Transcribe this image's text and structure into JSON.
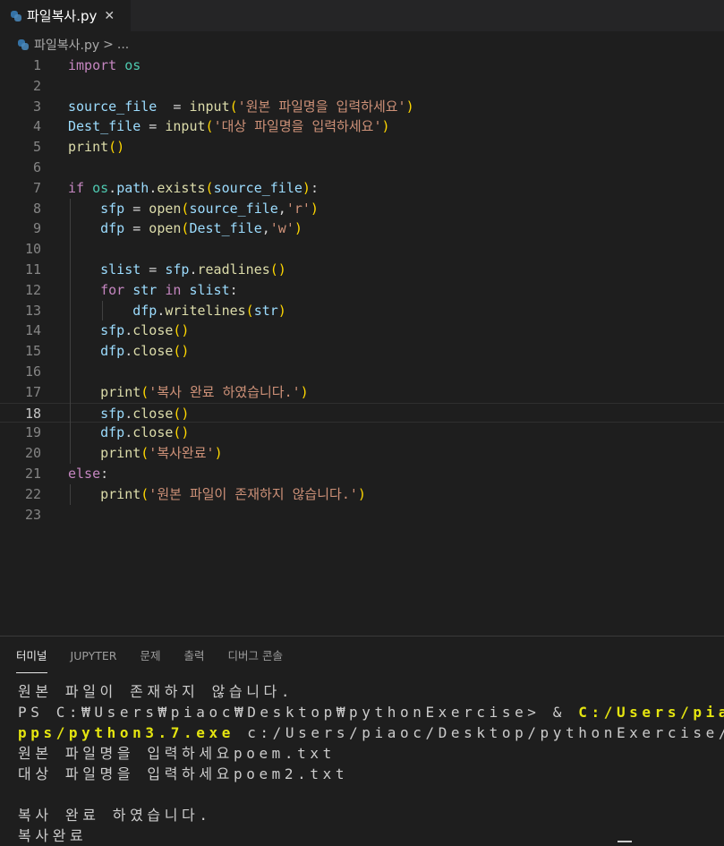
{
  "tab": {
    "title": "파일복사.py",
    "close": "✕"
  },
  "breadcrumb": {
    "file": "파일복사.py",
    "separator": ">",
    "more": "..."
  },
  "editor": {
    "current_line": 18,
    "lines": [
      {
        "n": "1",
        "indent": 0,
        "tokens": [
          [
            "kw",
            "import"
          ],
          [
            "op",
            " "
          ],
          [
            "mod",
            "os"
          ]
        ]
      },
      {
        "n": "2",
        "indent": 0,
        "tokens": []
      },
      {
        "n": "3",
        "indent": 0,
        "tokens": [
          [
            "var",
            "source_file"
          ],
          [
            "op",
            "  = "
          ],
          [
            "fn",
            "input"
          ],
          [
            "br1",
            "("
          ],
          [
            "str",
            "'원본 파일명을 입력하세요'"
          ],
          [
            "br1",
            ")"
          ]
        ]
      },
      {
        "n": "4",
        "indent": 0,
        "tokens": [
          [
            "var",
            "Dest_file"
          ],
          [
            "op",
            " = "
          ],
          [
            "fn",
            "input"
          ],
          [
            "br1",
            "("
          ],
          [
            "str",
            "'대상 파일명을 입력하세요'"
          ],
          [
            "br1",
            ")"
          ]
        ]
      },
      {
        "n": "5",
        "indent": 0,
        "tokens": [
          [
            "fn",
            "print"
          ],
          [
            "br1",
            "()"
          ]
        ]
      },
      {
        "n": "6",
        "indent": 0,
        "tokens": []
      },
      {
        "n": "7",
        "indent": 0,
        "tokens": [
          [
            "kw",
            "if"
          ],
          [
            "op",
            " "
          ],
          [
            "mod",
            "os"
          ],
          [
            "op",
            "."
          ],
          [
            "var",
            "path"
          ],
          [
            "op",
            "."
          ],
          [
            "fn",
            "exists"
          ],
          [
            "br1",
            "("
          ],
          [
            "var",
            "source_file"
          ],
          [
            "br1",
            ")"
          ],
          [
            "op",
            ":"
          ]
        ]
      },
      {
        "n": "8",
        "indent": 1,
        "tokens": [
          [
            "var",
            "sfp"
          ],
          [
            "op",
            " = "
          ],
          [
            "fn",
            "open"
          ],
          [
            "br1",
            "("
          ],
          [
            "var",
            "source_file"
          ],
          [
            "op",
            ","
          ],
          [
            "str",
            "'r'"
          ],
          [
            "br1",
            ")"
          ]
        ]
      },
      {
        "n": "9",
        "indent": 1,
        "tokens": [
          [
            "var",
            "dfp"
          ],
          [
            "op",
            " = "
          ],
          [
            "fn",
            "open"
          ],
          [
            "br1",
            "("
          ],
          [
            "var",
            "Dest_file"
          ],
          [
            "op",
            ","
          ],
          [
            "str",
            "'w'"
          ],
          [
            "br1",
            ")"
          ]
        ]
      },
      {
        "n": "10",
        "indent": 1,
        "tokens": []
      },
      {
        "n": "11",
        "indent": 1,
        "tokens": [
          [
            "var",
            "slist"
          ],
          [
            "op",
            " = "
          ],
          [
            "var",
            "sfp"
          ],
          [
            "op",
            "."
          ],
          [
            "fn",
            "readlines"
          ],
          [
            "br1",
            "()"
          ]
        ]
      },
      {
        "n": "12",
        "indent": 1,
        "tokens": [
          [
            "kw",
            "for"
          ],
          [
            "op",
            " "
          ],
          [
            "var",
            "str"
          ],
          [
            "op",
            " "
          ],
          [
            "kw",
            "in"
          ],
          [
            "op",
            " "
          ],
          [
            "var",
            "slist"
          ],
          [
            "op",
            ":"
          ]
        ]
      },
      {
        "n": "13",
        "indent": 2,
        "tokens": [
          [
            "var",
            "dfp"
          ],
          [
            "op",
            "."
          ],
          [
            "fn",
            "writelines"
          ],
          [
            "br1",
            "("
          ],
          [
            "var",
            "str"
          ],
          [
            "br1",
            ")"
          ]
        ]
      },
      {
        "n": "14",
        "indent": 1,
        "tokens": [
          [
            "var",
            "sfp"
          ],
          [
            "op",
            "."
          ],
          [
            "fn",
            "close"
          ],
          [
            "br1",
            "()"
          ]
        ]
      },
      {
        "n": "15",
        "indent": 1,
        "tokens": [
          [
            "var",
            "dfp"
          ],
          [
            "op",
            "."
          ],
          [
            "fn",
            "close"
          ],
          [
            "br1",
            "()"
          ]
        ]
      },
      {
        "n": "16",
        "indent": 1,
        "tokens": []
      },
      {
        "n": "17",
        "indent": 1,
        "tokens": [
          [
            "fn",
            "print"
          ],
          [
            "br1",
            "("
          ],
          [
            "str",
            "'복사 완료 하였습니다.'"
          ],
          [
            "br1",
            ")"
          ]
        ]
      },
      {
        "n": "18",
        "indent": 1,
        "tokens": [
          [
            "var",
            "sfp"
          ],
          [
            "op",
            "."
          ],
          [
            "fn",
            "close"
          ],
          [
            "br1",
            "()"
          ]
        ]
      },
      {
        "n": "19",
        "indent": 1,
        "tokens": [
          [
            "var",
            "dfp"
          ],
          [
            "op",
            "."
          ],
          [
            "fn",
            "close"
          ],
          [
            "br1",
            "()"
          ]
        ]
      },
      {
        "n": "20",
        "indent": 1,
        "tokens": [
          [
            "fn",
            "print"
          ],
          [
            "br1",
            "("
          ],
          [
            "str",
            "'복사완료'"
          ],
          [
            "br1",
            ")"
          ]
        ]
      },
      {
        "n": "21",
        "indent": 0,
        "tokens": [
          [
            "kw",
            "else"
          ],
          [
            "op",
            ":"
          ]
        ]
      },
      {
        "n": "22",
        "indent": 1,
        "tokens": [
          [
            "fn",
            "print"
          ],
          [
            "br1",
            "("
          ],
          [
            "str",
            "'원본 파일이 존재하지 않습니다.'"
          ],
          [
            "br1",
            ")"
          ]
        ]
      },
      {
        "n": "23",
        "indent": 0,
        "tokens": []
      }
    ]
  },
  "panel": {
    "tabs": [
      "터미널",
      "JUPYTER",
      "문제",
      "출력",
      "디버그 콘솔"
    ],
    "active_tab": 0
  },
  "terminal": {
    "lines": [
      [
        [
          "plain",
          "원본 파일이 존재하지 않습니다."
        ]
      ],
      [
        [
          "plain",
          "PS C:₩Users₩piaoc₩Desktop₩pythonExercise> & "
        ],
        [
          "yellow",
          "C:/Users/piaoc/AppData/Local/Microsoft/WindowsApps/"
        ]
      ],
      [
        [
          "yellow",
          "pps/python3.7.exe"
        ],
        [
          "plain",
          " c:/Users/piaoc/Desktop/pythonExercise/파일복사.py"
        ]
      ],
      [
        [
          "plain",
          "원본 파일명을 입력하세요poem.txt"
        ]
      ],
      [
        [
          "plain",
          "대상 파일명을 입력하세요poem2.txt"
        ]
      ],
      [
        [
          "plain",
          ""
        ]
      ],
      [
        [
          "plain",
          "복사 완료 하였습니다."
        ]
      ],
      [
        [
          "plain",
          "복사완료"
        ]
      ]
    ]
  }
}
